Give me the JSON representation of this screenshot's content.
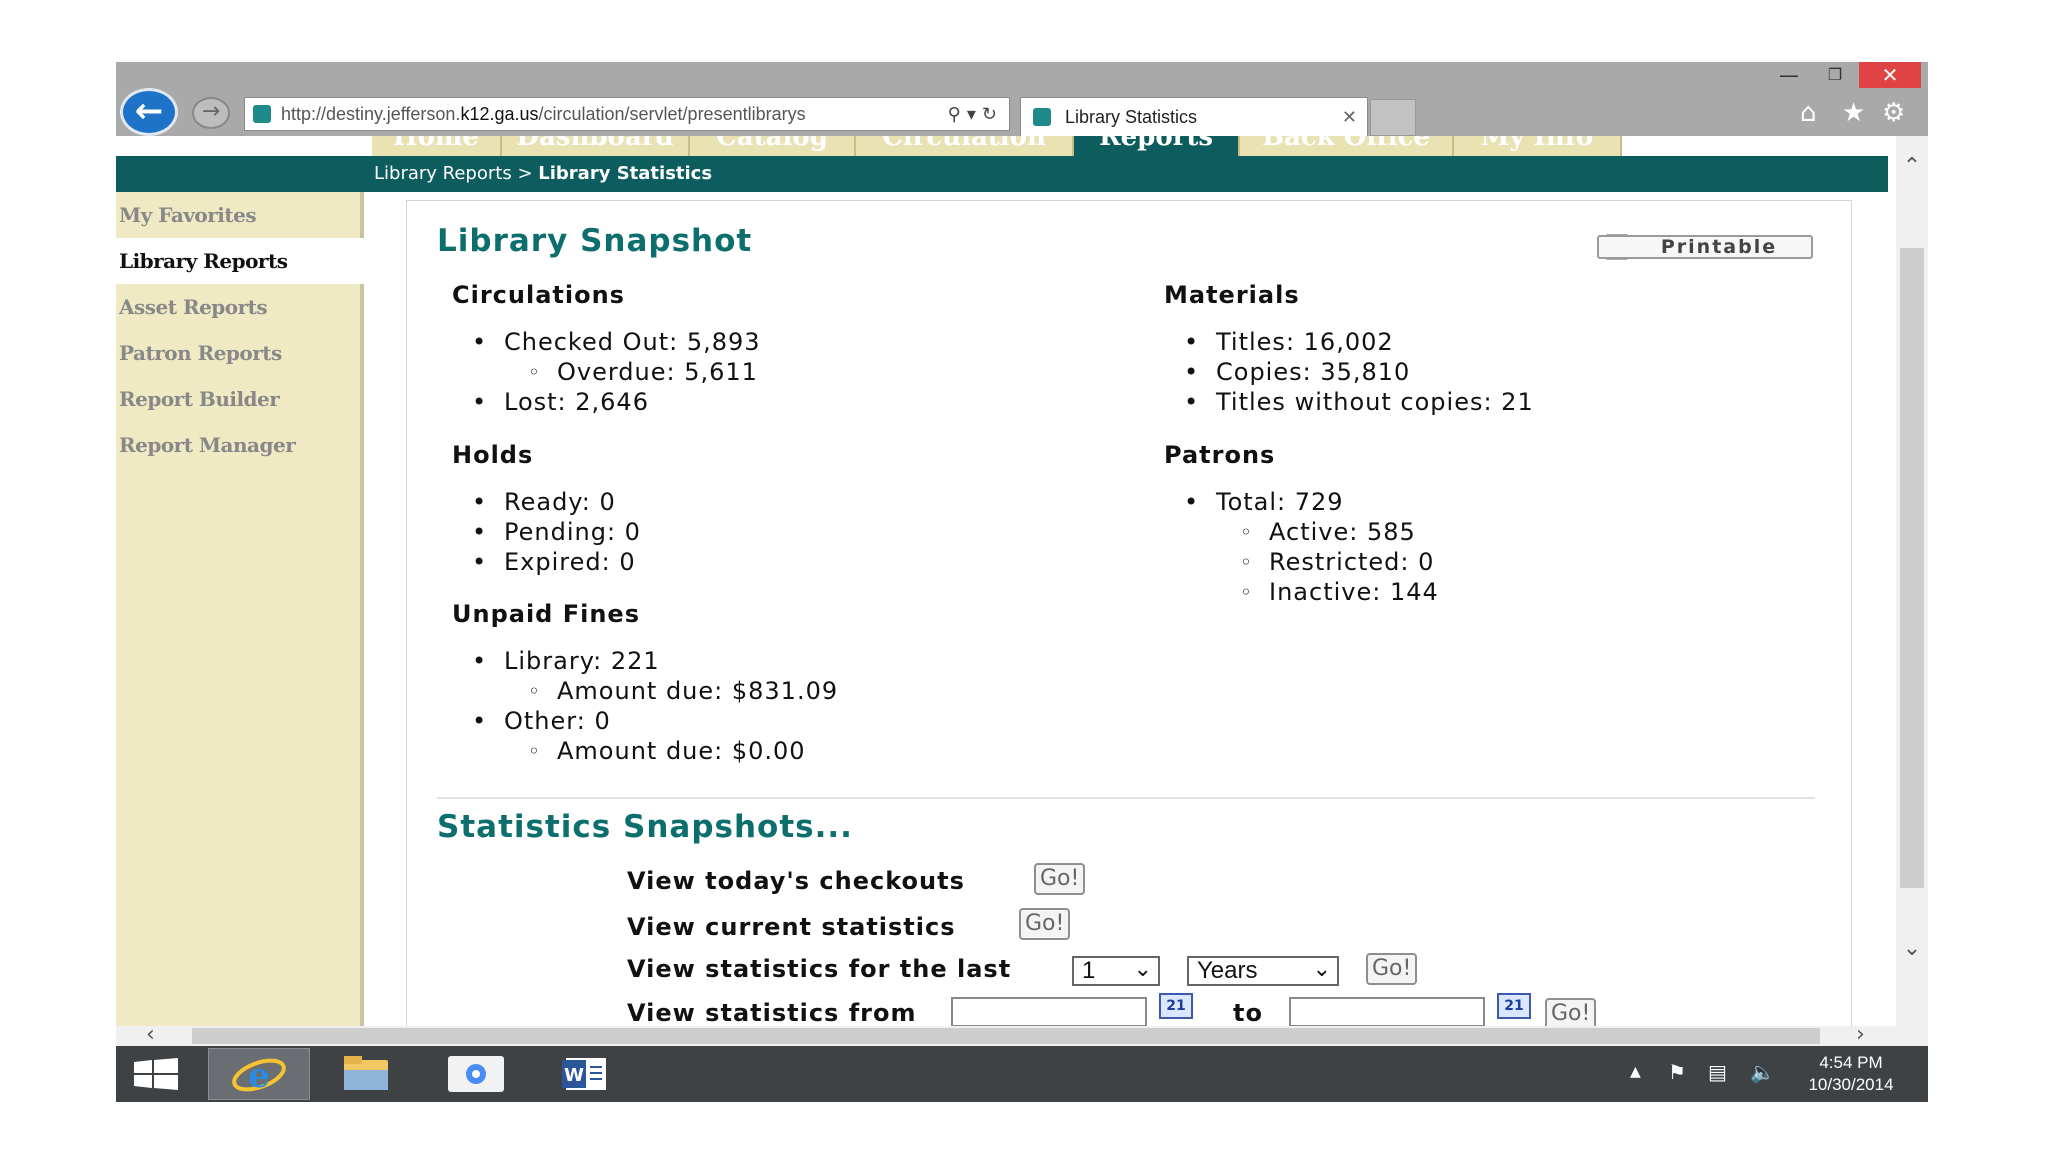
{
  "browser": {
    "url_prefix": "http://destiny.jefferson.",
    "url_host": "k12.ga.us",
    "url_rest": "/circulation/servlet/presentlibrarys",
    "tab_title": "Library Statistics",
    "tab_close": "✕"
  },
  "nav_tabs": [
    "Home",
    "Dashboard",
    "Catalog",
    "Circulation",
    "Reports",
    "Back Office",
    "My Info"
  ],
  "breadcrumb": {
    "parent": "Library Reports",
    "separator": ">",
    "current": "Library Statistics"
  },
  "sidebar": {
    "items": [
      "My Favorites",
      "Library Reports",
      "Asset Reports",
      "Patron Reports",
      "Report Builder",
      "Report Manager"
    ]
  },
  "snapshot": {
    "title": "Library Snapshot",
    "printable_label": "Printable",
    "circulations": {
      "heading": "Circulations",
      "checked_out": "Checked Out: 5,893",
      "overdue": "Overdue: 5,611",
      "lost": "Lost: 2,646"
    },
    "holds": {
      "heading": "Holds",
      "ready": "Ready: 0",
      "pending": "Pending: 0",
      "expired": "Expired: 0"
    },
    "fines": {
      "heading": "Unpaid Fines",
      "library": "Library: 221",
      "library_due": "Amount due: $831.09",
      "other": "Other: 0",
      "other_due": "Amount due: $0.00"
    },
    "materials": {
      "heading": "Materials",
      "titles": "Titles: 16,002",
      "copies": "Copies: 35,810",
      "without_copies": "Titles without copies: 21"
    },
    "patrons": {
      "heading": "Patrons",
      "total": "Total: 729",
      "active": "Active: 585",
      "restricted": "Restricted: 0",
      "inactive": "Inactive: 144"
    }
  },
  "stats": {
    "title": "Statistics Snapshots...",
    "today_label": "View today's checkouts",
    "current_label": "View current statistics",
    "last_label": "View statistics for the last",
    "last_count": "1",
    "last_unit": "Years",
    "from_label": "View statistics from",
    "to_label": "to",
    "go_label": "Go!"
  },
  "taskbar": {
    "time": "4:54 PM",
    "date": "10/30/2014"
  },
  "colors": {
    "teal": "#0d5d5f",
    "sidebar": "#efeac4",
    "close": "#e04343",
    "back_button": "#1e73c8"
  }
}
